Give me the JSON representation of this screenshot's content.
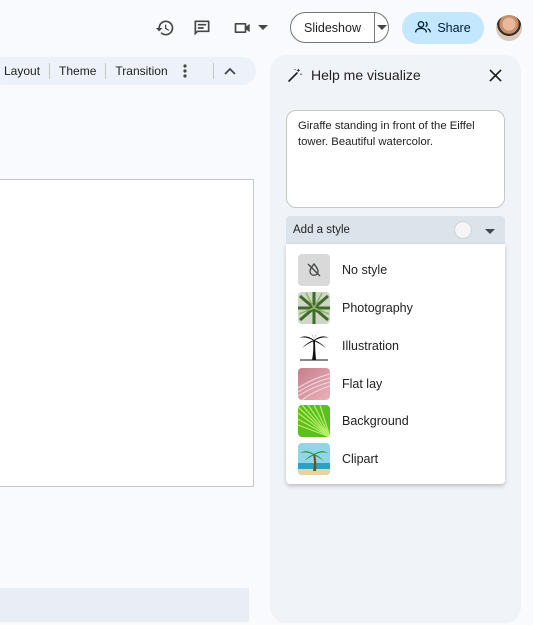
{
  "topbar": {
    "slideshow_label": "Slideshow",
    "share_label": "Share",
    "icons": [
      "history-icon",
      "comment-icon",
      "video-call-icon",
      "chevron-down-icon",
      "share-people-icon",
      "avatar"
    ]
  },
  "menubar": {
    "items": [
      "Layout",
      "Theme",
      "Transition"
    ]
  },
  "panel": {
    "title": "Help me visualize",
    "prompt_text": "Giraffe standing in front of the Eiffel tower. Beautiful watercolor.",
    "style_placeholder": "Add a style",
    "styles": [
      {
        "label": "No style",
        "icon": "no-style-icon"
      },
      {
        "label": "Photography",
        "icon": "photography-thumbnail"
      },
      {
        "label": "Illustration",
        "icon": "illustration-thumbnail"
      },
      {
        "label": "Flat lay",
        "icon": "flat-lay-thumbnail"
      },
      {
        "label": "Background",
        "icon": "background-thumbnail"
      },
      {
        "label": "Clipart",
        "icon": "clipart-thumbnail"
      }
    ]
  },
  "colors": {
    "share_bg": "#c2e7ff",
    "panel_bg": "#f0f4f9",
    "menubar_bg": "#edf2fa"
  }
}
